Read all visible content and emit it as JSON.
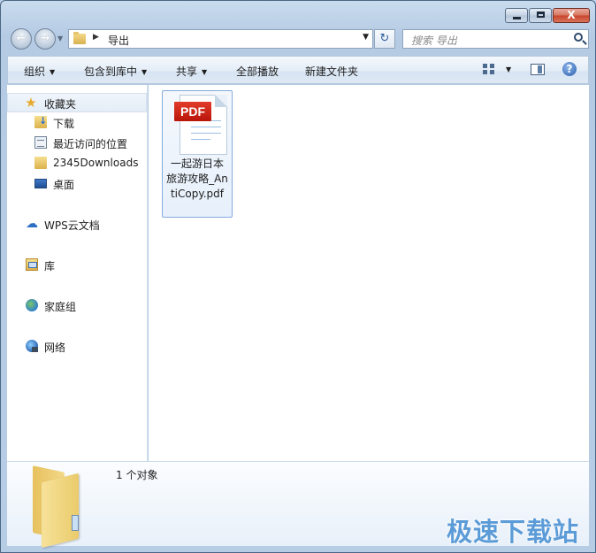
{
  "window": {
    "caption_minimize": "—",
    "caption_maximize": "□",
    "caption_close": "X"
  },
  "address_bar": {
    "path": "导出",
    "search_placeholder": "搜索 导出"
  },
  "toolbar": {
    "organize": "组织",
    "include_in_library": "包含到库中",
    "share": "共享",
    "play_all": "全部播放",
    "new_folder": "新建文件夹",
    "help": "?"
  },
  "navigation": {
    "favorites": "收藏夹",
    "favorite_items": [
      "下载",
      "最近访问的位置",
      "2345Downloads",
      "桌面"
    ],
    "wps_cloud": "WPS云文档",
    "libraries": "库",
    "homegroup": "家庭组",
    "network": "网络"
  },
  "files": [
    {
      "badge": "PDF",
      "name": "一起游日本旅游攻略_AntiCopy.pdf"
    }
  ],
  "details": {
    "item_count": "1 个对象"
  },
  "watermark": "极速下载站",
  "colors": {
    "accent": "#5b9bd7",
    "pdf_red": "#d42a1b",
    "chrome": "#bfd3ea"
  }
}
